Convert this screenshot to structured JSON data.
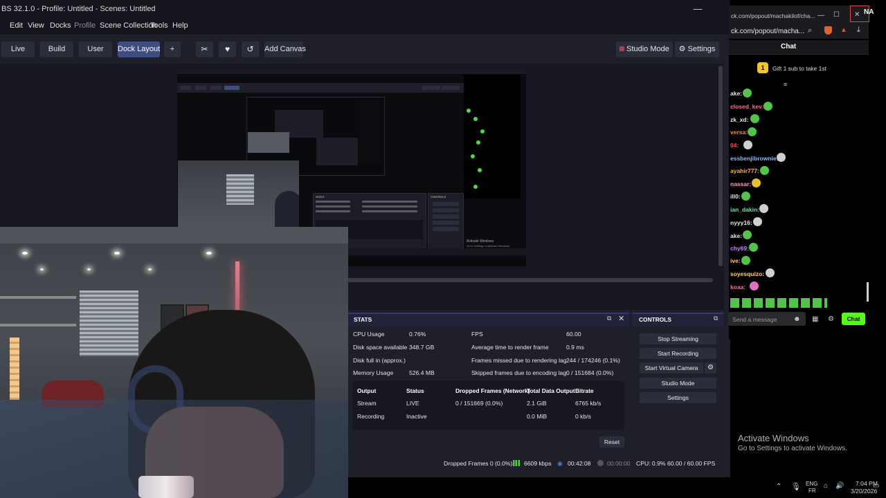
{
  "obs": {
    "title": "BS 32.1.0 - Profile: Untitled - Scenes: Untitled",
    "window_controls": {
      "minimize": "—",
      "maximize": "☐",
      "close": "✕"
    },
    "menu": [
      "Edit",
      "View",
      "Docks",
      "Profile",
      "Scene Collection",
      "Tools",
      "Help"
    ],
    "toolbar": {
      "live": "Live",
      "build": "Build",
      "user": "User",
      "dock_layout": "Dock Layout",
      "add": "+",
      "add_canvas": "Add Canvas",
      "studio_mode": "Studio Mode",
      "settings": "Settings"
    },
    "stats": {
      "title": "STATS",
      "cpu_label": "CPU Usage",
      "cpu_value": "0.76%",
      "disk_label": "Disk space available",
      "disk_value": "348.7 GB",
      "diskfull_label": "Disk full in (approx.)",
      "diskfull_value": "",
      "mem_label": "Memory Usage",
      "mem_value": "526.4 MB",
      "fps_label": "FPS",
      "fps_value": "60.00",
      "render_label": "Average time to render frame",
      "render_value": "0.9 ms",
      "missed_label": "Frames missed due to rendering lag",
      "missed_value": "244 / 174246 (0.1%)",
      "skipped_label": "Skipped frames due to encoding lag",
      "skipped_value": "0 / 151684 (0.0%)",
      "table": {
        "headers": [
          "Output",
          "Status",
          "Dropped Frames (Network)",
          "Total Data Output",
          "Bitrate"
        ],
        "rows": [
          [
            "Stream",
            "LIVE",
            "0 / 151669 (0.0%)",
            "2.1 GiB",
            "6765 kb/s"
          ],
          [
            "Recording",
            "Inactive",
            "",
            "0.0 MiB",
            "0 kb/s"
          ]
        ]
      },
      "reset": "Reset"
    },
    "controls": {
      "title": "CONTROLS",
      "stop_streaming": "Stop Streaming",
      "start_recording": "Start Recording",
      "start_virtual_camera": "Start Virtual Camera",
      "studio_mode": "Studio Mode",
      "settings": "Settings"
    },
    "status": {
      "dropped": "Dropped Frames 0 (0.0%)",
      "kbps": "6609 kbps",
      "stream_time": "00:42:08",
      "rec_time": "00:00:00",
      "cpu": "CPU: 0.9%",
      "fps": "60.00 / 60.00 FPS"
    }
  },
  "browser": {
    "tab_title": "ck.com/popout/machakilof/cha...",
    "url": "ck.com/popout/macha...",
    "chat": {
      "title": "Chat",
      "pinned": "Gift 1 sub to take 1st",
      "messages": [
        {
          "user": "ake:",
          "color": "#e8e8e8"
        },
        {
          "user": "closed_kev:",
          "color": "#ff6f91"
        },
        {
          "user": "zk_xd:",
          "color": "#e8e8e8"
        },
        {
          "user": "versa:",
          "color": "#ff8a3d"
        },
        {
          "user": "04:",
          "color": "#ff4d4d"
        },
        {
          "user": "essbenjibrownie:",
          "color": "#8fb8ff"
        },
        {
          "user": "ayahir777:",
          "color": "#ffb347"
        },
        {
          "user": "nassar:",
          "color": "#ff9ec4"
        },
        {
          "user": "ill0:",
          "color": "#e8e8e8"
        },
        {
          "user": "ian_dakin:",
          "color": "#6fe3a3"
        },
        {
          "user": "nyyy16:",
          "color": "#e8e8e8"
        },
        {
          "user": "ake:",
          "color": "#e8e8e8"
        },
        {
          "user": "chy69:",
          "color": "#c58bff"
        },
        {
          "user": "ive:",
          "color": "#ffd166"
        },
        {
          "user": "soyesquizo:",
          "color": "#ffd166"
        },
        {
          "user": "koaa:",
          "color": "#ff6f91"
        }
      ],
      "input_placeholder": "Send a message",
      "send": "Chat"
    }
  },
  "desktop": {
    "activate_title": "Activate Windows",
    "activate_sub": "Go to Settings to activate Windows.",
    "lang": "ENG",
    "lang_sub": "FR",
    "time": "7:04 PM",
    "date": "3/20/2026",
    "corner_text": "NA"
  },
  "nested_capture": {
    "stats_title": "STATS",
    "controls_title": "CONTROLS",
    "activate_title": "Activate Windows",
    "activate_sub": "Go to Settings to activate Windows."
  },
  "colors": {
    "accent_blue": "#3d4d7e",
    "live_green": "#53fc18",
    "obs_bg": "#1e1f29"
  }
}
